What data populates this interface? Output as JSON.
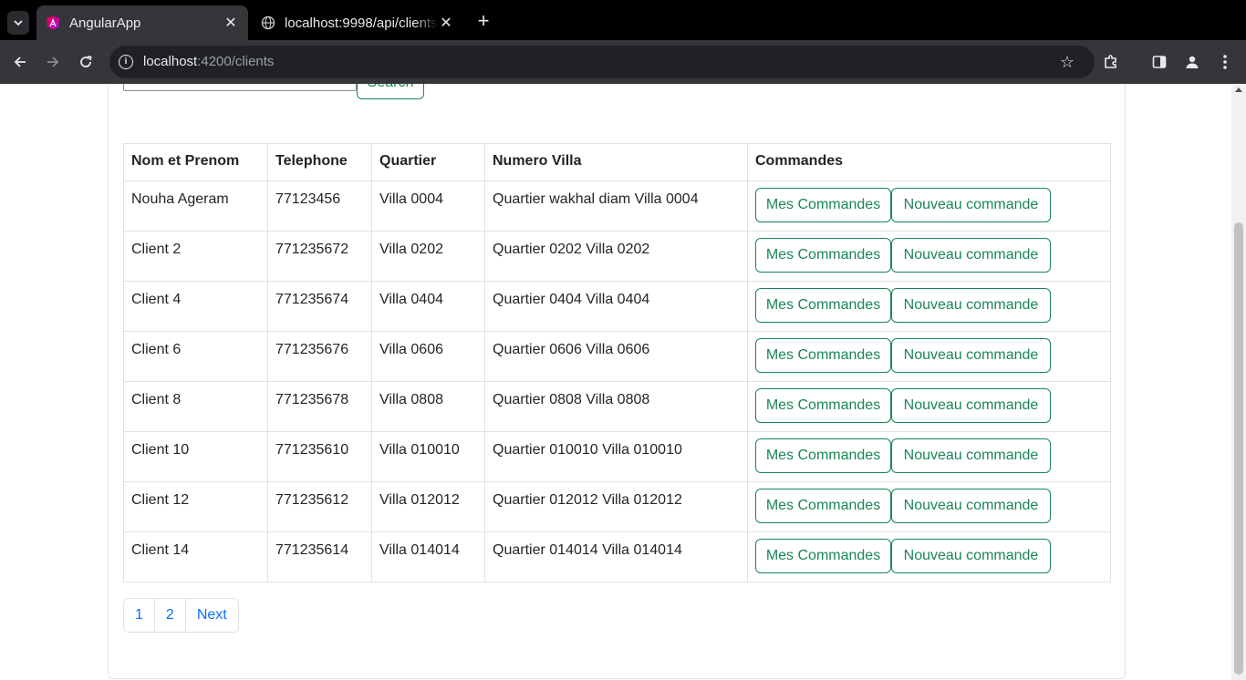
{
  "browser": {
    "tabs": [
      {
        "title": "AngularApp",
        "active": true,
        "favicon": "angular-logo-icon"
      },
      {
        "title": "localhost:9998/api/clients",
        "active": false,
        "favicon": "globe-icon"
      }
    ],
    "url_host": "localhost",
    "url_path": ":4200/clients"
  },
  "search": {
    "value": "",
    "button_label": "Search"
  },
  "table": {
    "headers": [
      "Nom et Prenom",
      "Telephone",
      "Quartier",
      "Numero Villa",
      "Commandes"
    ],
    "rows": [
      {
        "nom": "Nouha Ageram",
        "telephone": "77123456",
        "quartier": "Villa 0004",
        "villa": "Quartier wakhal diam Villa 0004"
      },
      {
        "nom": "Client 2",
        "telephone": "771235672",
        "quartier": "Villa 0202",
        "villa": "Quartier 0202 Villa 0202"
      },
      {
        "nom": "Client 4",
        "telephone": "771235674",
        "quartier": "Villa 0404",
        "villa": "Quartier 0404 Villa 0404"
      },
      {
        "nom": "Client 6",
        "telephone": "771235676",
        "quartier": "Villa 0606",
        "villa": "Quartier 0606 Villa 0606"
      },
      {
        "nom": "Client 8",
        "telephone": "771235678",
        "quartier": "Villa 0808",
        "villa": "Quartier 0808 Villa 0808"
      },
      {
        "nom": "Client 10",
        "telephone": "771235610",
        "quartier": "Villa 010010",
        "villa": "Quartier 010010 Villa 010010"
      },
      {
        "nom": "Client 12",
        "telephone": "771235612",
        "quartier": "Villa 012012",
        "villa": "Quartier 012012 Villa 012012"
      },
      {
        "nom": "Client 14",
        "telephone": "771235614",
        "quartier": "Villa 014014",
        "villa": "Quartier 014014 Villa 014014"
      }
    ],
    "mes_commandes_label": "Mes Commandes",
    "nouveau_commande_label": "Nouveau commande"
  },
  "pagination": {
    "pages": [
      "1",
      "2"
    ],
    "next_label": "Next"
  },
  "colors": {
    "success": "#198754",
    "link": "#0d6efd",
    "border": "#dee2e6"
  }
}
